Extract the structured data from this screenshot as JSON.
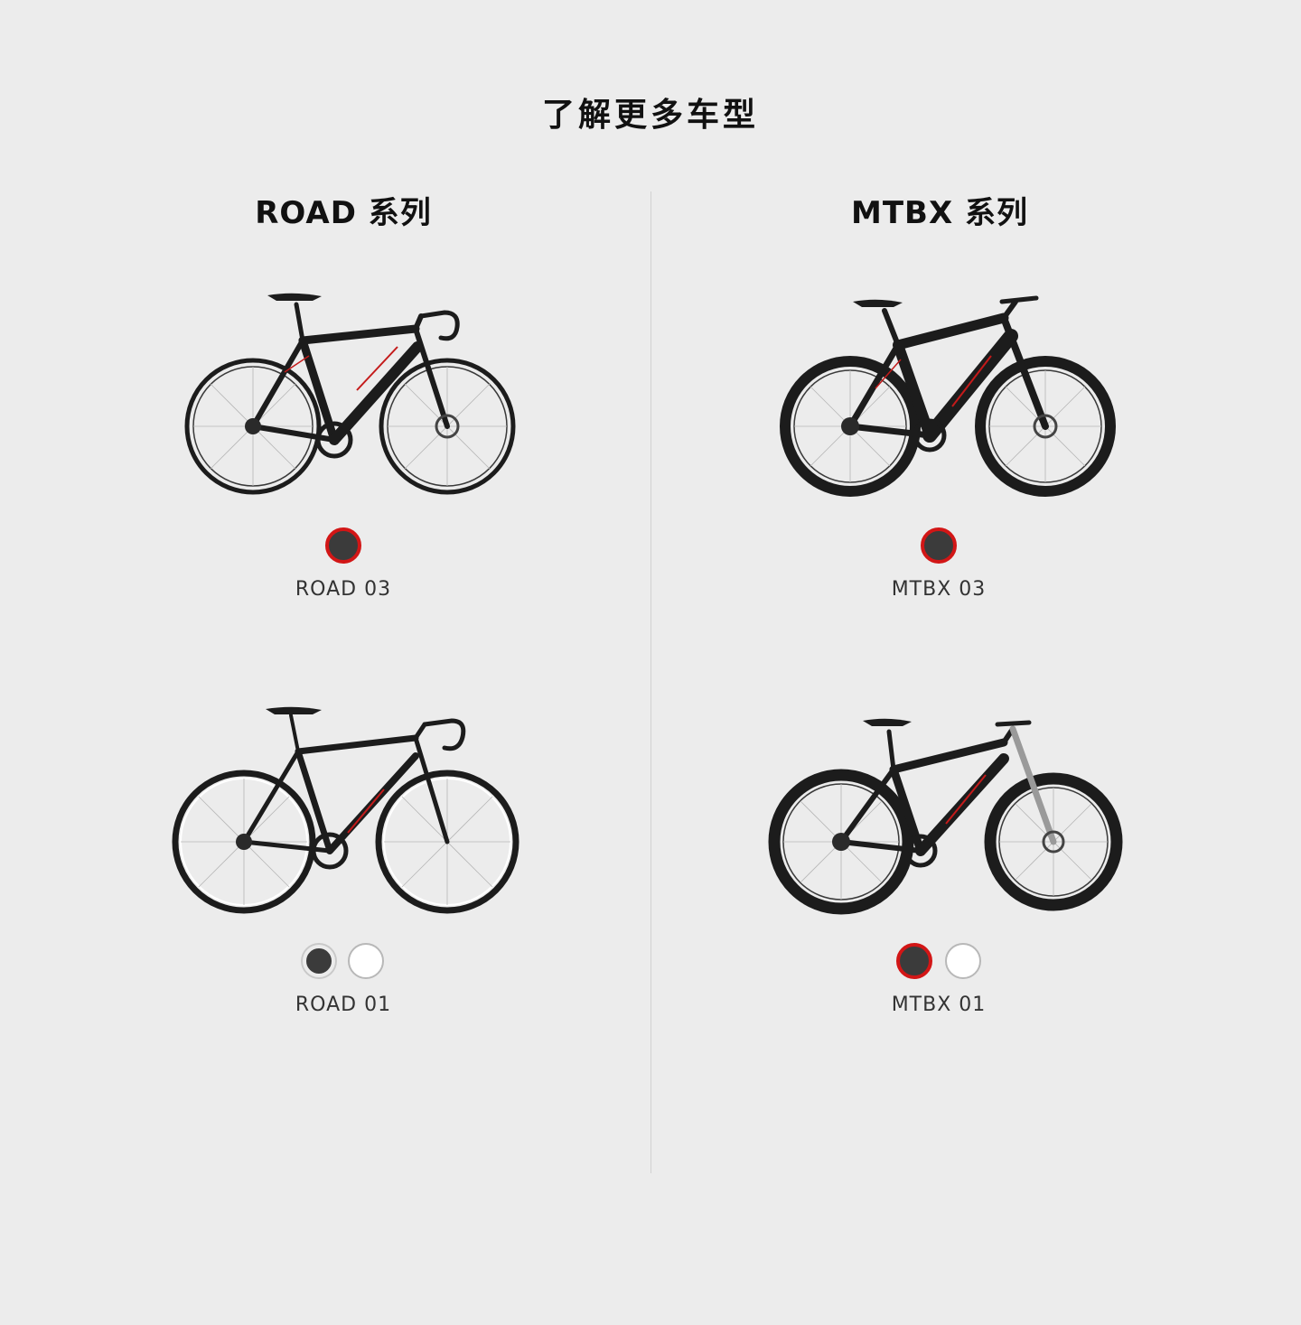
{
  "page": {
    "title": "了解更多车型"
  },
  "series": {
    "road": {
      "title": "ROAD 系列"
    },
    "mtbx": {
      "title": "MTBX 系列"
    }
  },
  "models": {
    "road03": {
      "name": "ROAD 03",
      "bike_type": "road",
      "colors": [
        "dark"
      ],
      "selected_color": "dark"
    },
    "mtbx03": {
      "name": "MTBX 03",
      "bike_type": "mountain",
      "colors": [
        "dark"
      ],
      "selected_color": "dark"
    },
    "road01": {
      "name": "ROAD 01",
      "bike_type": "road",
      "colors": [
        "dark",
        "light"
      ],
      "selected_color": "none"
    },
    "mtbx01": {
      "name": "MTBX 01",
      "bike_type": "mountain",
      "colors": [
        "dark",
        "light"
      ],
      "selected_color": "dark"
    }
  },
  "colors": {
    "background": "#ececec",
    "accent": "#d21616",
    "frame": "#1c1c1c",
    "frame_decal": "#c41a1a",
    "swatch_dark": "#3b3b3b",
    "swatch_light": "#ffffff",
    "divider": "#d2d2d2"
  },
  "icons": {
    "bike_image": "bicycle-illustration"
  }
}
